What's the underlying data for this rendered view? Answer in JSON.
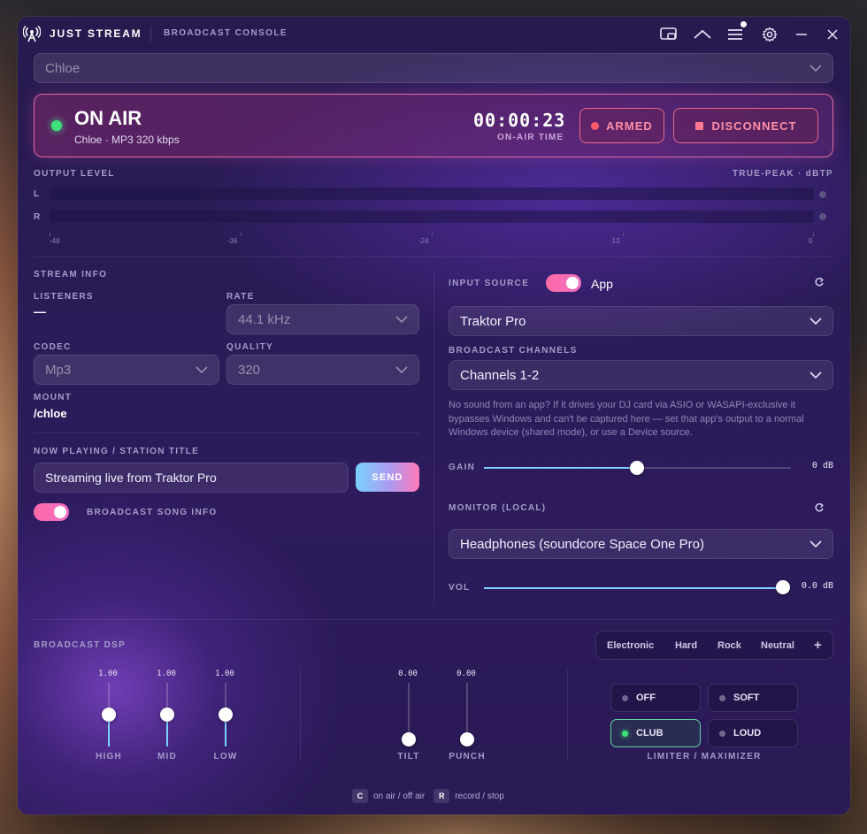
{
  "app": {
    "name": "JUST STREAM",
    "subtitle": "BROADCAST CONSOLE"
  },
  "station_select": {
    "value": "Chloe"
  },
  "status": {
    "state": "ON AIR",
    "details": "Chloe · MP3 320 kbps",
    "timer": "00:00:23",
    "timer_label": "ON-AIR TIME",
    "armed_label": "ARMED",
    "disconnect_label": "DISCONNECT"
  },
  "output": {
    "label": "OUTPUT LEVEL",
    "scale_label": "TRUE-PEAK · dBTP",
    "channels": [
      "L",
      "R"
    ],
    "ticks": [
      "-48",
      "-36",
      "-24",
      "-12",
      "0"
    ]
  },
  "stream_info": {
    "heading": "STREAM INFO",
    "listeners_label": "LISTENERS",
    "listeners_value": "—",
    "rate_label": "RATE",
    "rate_value": "44.1 kHz",
    "codec_label": "CODEC",
    "codec_value": "Mp3",
    "quality_label": "QUALITY",
    "quality_value": "320",
    "mount_label": "MOUNT",
    "mount_value": "/chloe"
  },
  "now_playing": {
    "heading": "NOW PLAYING / STATION TITLE",
    "value": "Streaming live from Traktor Pro",
    "send_label": "SEND",
    "toggle_label": "BROADCAST SONG INFO",
    "toggle_on": true
  },
  "input": {
    "heading": "INPUT SOURCE",
    "mode_label": "App",
    "mode_on": true,
    "source_value": "Traktor Pro",
    "channels_heading": "BROADCAST CHANNELS",
    "channels_value": "Channels 1-2",
    "help": "No sound from an app? If it drives your DJ card via ASIO or WASAPI-exclusive it bypasses Windows and can't be captured here — set that app's output to a normal Windows device (shared mode), or use a Device source.",
    "gain_label": "GAIN",
    "gain_value": "0 dB",
    "gain_level": 0.5
  },
  "monitor": {
    "heading": "MONITOR (LOCAL)",
    "device_value": "Headphones (soundcore Space One Pro)",
    "vol_label": "VOL",
    "vol_value": "0.0 dB",
    "vol_level": 1.0
  },
  "dsp": {
    "heading": "BROADCAST DSP",
    "presets": [
      "Electronic",
      "Hard",
      "Rock",
      "Neutral"
    ],
    "add_label": "+",
    "eq": [
      {
        "label": "HIGH",
        "value": "1.00",
        "level": 0.5
      },
      {
        "label": "MID",
        "value": "1.00",
        "level": 0.5
      },
      {
        "label": "LOW",
        "value": "1.00",
        "level": 0.5
      }
    ],
    "tone": [
      {
        "label": "TILT",
        "value": "0.00",
        "level": 0.0
      },
      {
        "label": "PUNCH",
        "value": "0.00",
        "level": 0.0
      }
    ],
    "limiter_modes": [
      {
        "label": "OFF",
        "active": false
      },
      {
        "label": "SOFT",
        "active": false
      },
      {
        "label": "CLUB",
        "active": true
      },
      {
        "label": "LOUD",
        "active": false
      }
    ],
    "limiter_label": "LIMITER / MAXIMIZER"
  },
  "shortcuts": [
    {
      "key": "C",
      "label": "on air / off air"
    },
    {
      "key": "R",
      "label": "record / stop"
    }
  ],
  "colors": {
    "accent_pink": "#ff6aa8",
    "accent_blue": "#7ad2ff",
    "live_green": "#3ee07a",
    "alert_red": "#e86a86"
  }
}
